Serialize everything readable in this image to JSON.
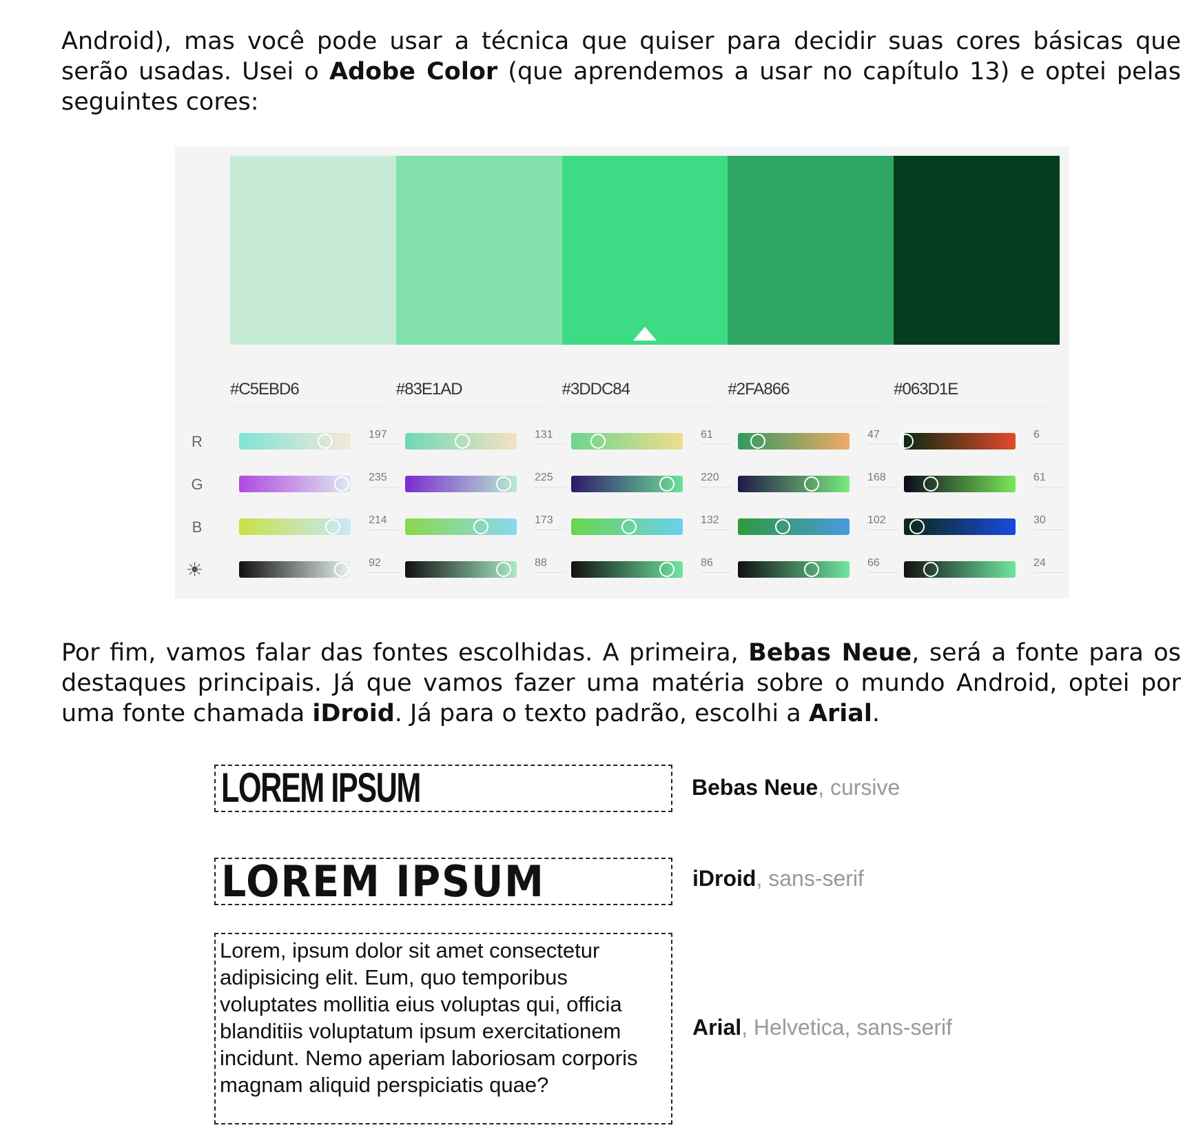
{
  "paragraphs": {
    "intro": {
      "t1": "Android), mas você pode usar a técnica que quiser para decidir suas cores básicas que serão usadas. Usei o ",
      "b1": "Adobe Color",
      "t2": " (que aprendemos a usar no capítulo 13) e optei pelas seguintes cores:"
    },
    "fonts": {
      "t1": "Por fim, vamos falar das fontes escolhidas. A primeira, ",
      "b1": "Bebas Neue",
      "t2": ", será a fonte para os destaques principais. Já que vamos fazer uma matéria sobre o mundo Android, optei por uma fonte chamada ",
      "b2": "iDroid",
      "t3": ". Já para o texto padrão, escolhi a ",
      "b3": "Arial",
      "t4": "."
    }
  },
  "palette": {
    "swatches": [
      {
        "hex": "#C5EBD6",
        "color": "#C5EBD6",
        "r": "197",
        "g": "235",
        "b": "214",
        "bri": "92",
        "rv": 0.77,
        "gv": 0.92,
        "bv": 0.84,
        "briv": 0.92
      },
      {
        "hex": "#83E1AD",
        "color": "#83E1AD",
        "r": "131",
        "g": "225",
        "b": "173",
        "bri": "88",
        "rv": 0.51,
        "gv": 0.88,
        "bv": 0.68,
        "briv": 0.88
      },
      {
        "hex": "#3DDC84",
        "color": "#3DDC84",
        "r": "61",
        "g": "220",
        "b": "132",
        "bri": "86",
        "rv": 0.24,
        "gv": 0.86,
        "bv": 0.52,
        "briv": 0.86
      },
      {
        "hex": "#2FA866",
        "color": "#2FA866",
        "r": "47",
        "g": "168",
        "b": "102",
        "bri": "66",
        "rv": 0.18,
        "gv": 0.66,
        "bv": 0.4,
        "briv": 0.66
      },
      {
        "hex": "#063D1E",
        "color": "#063D1E",
        "r": "6",
        "g": "61",
        "b": "30",
        "bri": "24",
        "rv": 0.02,
        "gv": 0.24,
        "bv": 0.12,
        "briv": 0.24
      }
    ],
    "selected_index": 2,
    "channels": [
      "R",
      "G",
      "B",
      "☀"
    ],
    "gradients": {
      "R": [
        [
          "#7fe3d6",
          "#f5e8d8"
        ],
        [
          "#6fd9b4",
          "#f5e2c0"
        ],
        [
          "#6ad68f",
          "#f0dc8c"
        ],
        [
          "#2f9a5e",
          "#f0aa66"
        ],
        [
          "#0a2a10",
          "#e24a2a"
        ]
      ],
      "G": [
        [
          "#b04ae0",
          "#dde9f0"
        ],
        [
          "#7a2cd0",
          "#b8ecd0"
        ],
        [
          "#2c1a6a",
          "#6fe09a"
        ],
        [
          "#22184a",
          "#7aea7a"
        ],
        [
          "#0a0a1e",
          "#7ae85a"
        ]
      ],
      "B": [
        [
          "#c8e04a",
          "#c8e8f8"
        ],
        [
          "#8ad84a",
          "#8ad8f0"
        ],
        [
          "#6ad64a",
          "#6ad0f0"
        ],
        [
          "#2f9a3a",
          "#4a9ae0"
        ],
        [
          "#0a2a10",
          "#1a4ae0"
        ]
      ],
      "bri": [
        [
          "#111111",
          "#e8f4ee"
        ],
        [
          "#111111",
          "#a8ecc6"
        ],
        [
          "#111111",
          "#6ee69e"
        ],
        [
          "#111111",
          "#6ee69e"
        ],
        [
          "#111111",
          "#6ee69e"
        ]
      ]
    }
  },
  "font_samples": [
    {
      "sample": "LOREM IPSUM",
      "name": "Bebas Neue",
      "stack": ", cursive"
    },
    {
      "sample": "LOREM IPSUM",
      "name": "iDroid",
      "stack": ", sans-serif"
    },
    {
      "sample": "Lorem, ipsum dolor sit amet consectetur adipisicing elit. Eum, quo temporibus voluptates mollitia eius voluptas qui, officia blanditiis voluptatum ipsum exercitationem incidunt. Nemo aperiam laboriosam corporis magnam aliquid perspiciatis quae?",
      "name": "Arial",
      "stack": ", Helvetica, sans-serif"
    }
  ]
}
